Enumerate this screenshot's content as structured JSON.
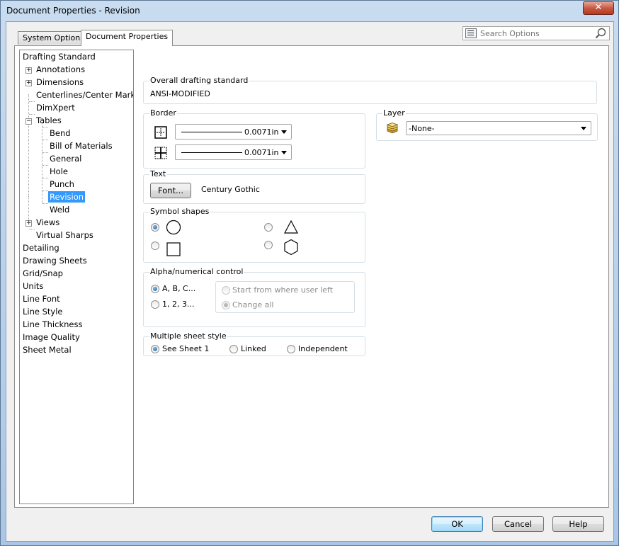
{
  "window": {
    "title": "Document Properties - Revision",
    "close_glyph": "✕"
  },
  "tabs": [
    {
      "label": "System Options"
    },
    {
      "label": "Document Properties"
    }
  ],
  "search": {
    "placeholder": "Search Options"
  },
  "tree": {
    "items": [
      {
        "label": "Drafting Standard"
      },
      {
        "label": "Annotations"
      },
      {
        "label": "Dimensions"
      },
      {
        "label": "Centerlines/Center Marks"
      },
      {
        "label": "DimXpert"
      },
      {
        "label": "Tables"
      },
      {
        "label": "Bend"
      },
      {
        "label": "Bill of Materials"
      },
      {
        "label": "General"
      },
      {
        "label": "Hole"
      },
      {
        "label": "Punch"
      },
      {
        "label": "Revision"
      },
      {
        "label": "Weld"
      },
      {
        "label": "Views"
      },
      {
        "label": "Virtual Sharps"
      },
      {
        "label": "Detailing"
      },
      {
        "label": "Drawing Sheets"
      },
      {
        "label": "Grid/Snap"
      },
      {
        "label": "Units"
      },
      {
        "label": "Line Font"
      },
      {
        "label": "Line Style"
      },
      {
        "label": "Line Thickness"
      },
      {
        "label": "Image Quality"
      },
      {
        "label": "Sheet Metal"
      }
    ],
    "selected": "Revision"
  },
  "overall": {
    "label": "Overall drafting standard",
    "value": "ANSI-MODIFIED"
  },
  "border": {
    "label": "Border",
    "outer_value": "0.0071in",
    "inner_value": "0.0071in"
  },
  "text": {
    "label": "Text",
    "font_button": "Font...",
    "font_name": "Century Gothic"
  },
  "symbol_shapes": {
    "label": "Symbol shapes",
    "selected": "circle"
  },
  "alpha": {
    "label": "Alpha/numerical control",
    "option_alpha": "A, B, C...",
    "option_numeric": "1, 2, 3...",
    "option_start": "Start from where user left",
    "option_change": "Change all"
  },
  "multisheet": {
    "label": "Multiple sheet style",
    "option_see": "See Sheet 1",
    "option_linked": "Linked",
    "option_independent": "Independent"
  },
  "layer": {
    "label": "Layer",
    "value": "-None-"
  },
  "footer": {
    "ok": "OK",
    "cancel": "Cancel",
    "help": "Help"
  }
}
